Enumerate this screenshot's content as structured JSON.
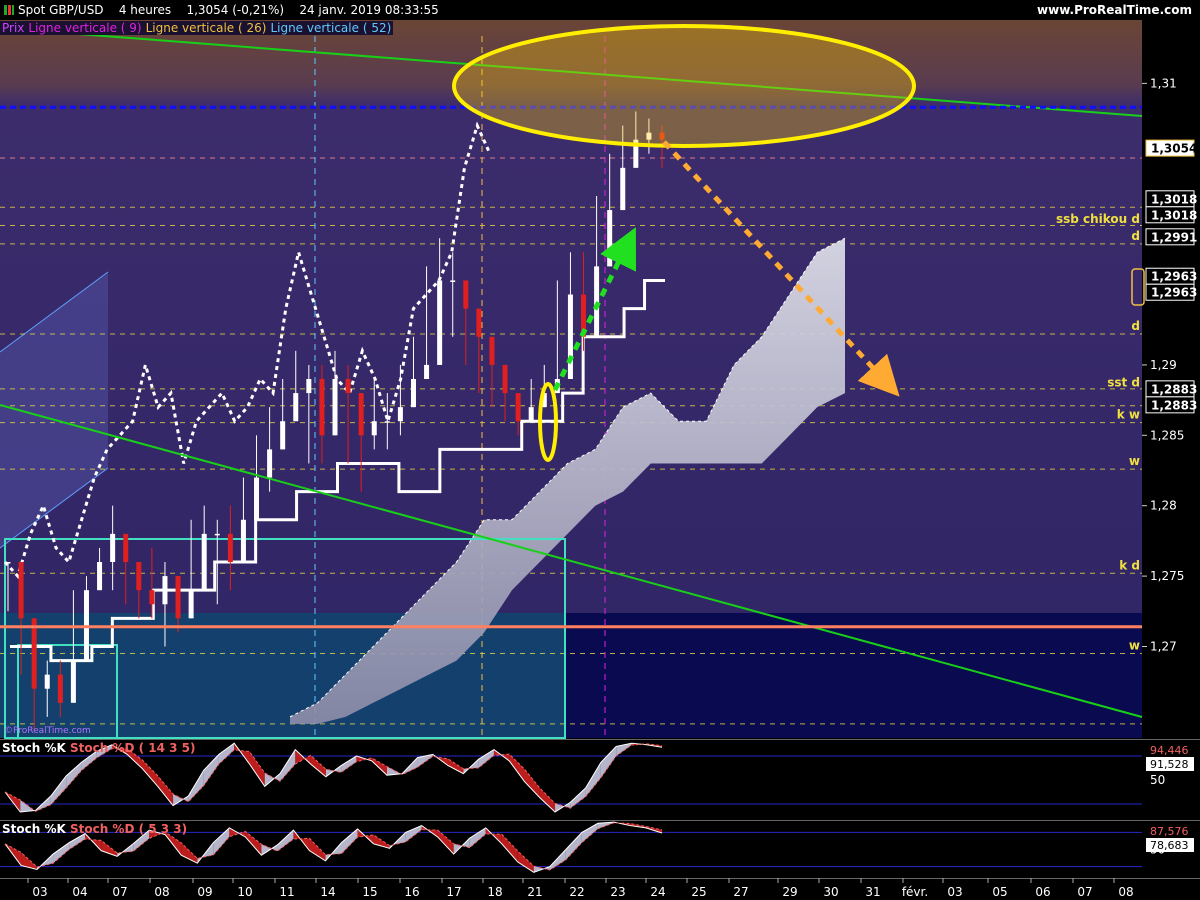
{
  "header": {
    "instrument": "Spot GBP/USD",
    "timeframe": "4 heures",
    "last": "1,3054 (-0,21%)",
    "datetime": "24 janv. 2019 08:33:55",
    "brand": "www.ProRealTime.com"
  },
  "legend": [
    {
      "text": "Prix",
      "color": "#cc44ff"
    },
    {
      "text": "Ligne verticale ( 9)",
      "color": "#e020e0"
    },
    {
      "text": "Ligne verticale ( 26)",
      "color": "#f0c040"
    },
    {
      "text": "Ligne verticale ( 52)",
      "color": "#60c8ff"
    }
  ],
  "watermark": "©ProRealTime.com",
  "colors": {
    "background_top": "#6b4535",
    "background": "#3a2a6a",
    "background_bottom": "#0a0a50",
    "ichimoku_cloud": "#c8c8d8",
    "trend_line": "#18d018",
    "resistance_dotted": "#1010ff",
    "support_horizontal": "#ff8060",
    "arrow_projection": "#ffaa33",
    "arrow_breakout": "#20e020",
    "highlight_ellipse": "#ffee00",
    "price_up": "#ffffff",
    "price_down": "#e02020",
    "box": "#40e0c0"
  },
  "chart_data": [
    {
      "type": "line",
      "title": "",
      "description_series": "Spot GBP/USD 4h with Ichimoku (Kijun, Chikou, Kumo), trend lines",
      "ylim": [
        1.2635,
        1.3145
      ],
      "x_ticks": [
        "03",
        "04",
        "07",
        "08",
        "09",
        "10",
        "11",
        "14",
        "15",
        "16",
        "17",
        "18",
        "21",
        "22",
        "23",
        "24",
        "25",
        "27",
        "29",
        "30",
        "31",
        "févr.",
        "03",
        "05",
        "06",
        "07",
        "08"
      ],
      "y_ticks": [
        {
          "value": 1.31,
          "label": "1,31"
        },
        {
          "value": 1.29,
          "label": "1,29"
        },
        {
          "value": 1.285,
          "label": "1,285"
        },
        {
          "value": 1.28,
          "label": "1,28"
        },
        {
          "value": 1.275,
          "label": "1,275"
        },
        {
          "value": 1.27,
          "label": "1,27"
        }
      ],
      "price_tags": [
        {
          "value": 1.3054,
          "label": "1,3054",
          "highlight": true
        },
        {
          "value": 1.3018,
          "label": "1,3018"
        },
        {
          "value": 1.3018,
          "label": "1,3018"
        },
        {
          "value": 1.2991,
          "label": "1,2991"
        },
        {
          "value": 1.2963,
          "label": "1,2963"
        },
        {
          "value": 1.2963,
          "label": "1,2963"
        },
        {
          "value": 1.2883,
          "label": "1,2883"
        },
        {
          "value": 1.2883,
          "label": "1,2883"
        }
      ],
      "level_labels": [
        {
          "value": 1.2998,
          "label": "ssb chikou d"
        },
        {
          "value": 1.2986,
          "label": "d"
        },
        {
          "value": 1.2922,
          "label": "d"
        },
        {
          "value": 1.2882,
          "label": "sst d"
        },
        {
          "value": 1.2859,
          "label": "k w"
        },
        {
          "value": 1.2826,
          "label": "w"
        },
        {
          "value": 1.2752,
          "label": "k d"
        },
        {
          "value": 1.2695,
          "label": "w"
        }
      ],
      "dashed_levels": [
        1.3047,
        1.3012,
        1.2999,
        1.2986,
        1.2922,
        1.2883,
        1.2871,
        1.2859,
        1.2826,
        1.2752,
        1.2695,
        1.2645
      ],
      "resistance_level": 1.3083,
      "support_level": 1.2714,
      "vertical_lines": [
        {
          "name": "Ligne verticale ( 52)",
          "date": "14",
          "color": "#60c8ff"
        },
        {
          "name": "Ligne verticale ( 26)",
          "date": "18",
          "color": "#f0c040"
        },
        {
          "name": "Ligne verticale ( 9)",
          "date": "23",
          "color": "#e020e0"
        }
      ],
      "candles": [
        [
          1.276,
          1.2755,
          1.2725
        ],
        [
          1.272,
          1.271,
          1.268
        ],
        [
          1.267,
          1.27,
          1.264
        ],
        [
          1.268,
          1.269,
          1.265
        ],
        [
          1.266,
          1.269,
          1.265
        ],
        [
          1.269,
          1.274,
          1.268
        ],
        [
          1.274,
          1.275,
          1.272
        ],
        [
          1.276,
          1.277,
          1.274
        ],
        [
          1.278,
          1.28,
          1.274
        ],
        [
          1.276,
          1.277,
          1.273
        ],
        [
          1.274,
          1.276,
          1.272
        ],
        [
          1.273,
          1.277,
          1.272
        ],
        [
          1.275,
          1.276,
          1.27
        ],
        [
          1.272,
          1.275,
          1.271
        ],
        [
          1.274,
          1.279,
          1.273
        ],
        [
          1.278,
          1.28,
          1.276
        ],
        [
          1.278,
          1.279,
          1.273
        ],
        [
          1.276,
          1.28,
          1.274
        ],
        [
          1.279,
          1.282,
          1.278
        ],
        [
          1.282,
          1.285,
          1.28
        ],
        [
          1.284,
          1.287,
          1.281
        ],
        [
          1.286,
          1.289,
          1.284
        ],
        [
          1.288,
          1.291,
          1.286
        ],
        [
          1.289,
          1.29,
          1.283
        ],
        [
          1.285,
          1.29,
          1.283
        ],
        [
          1.289,
          1.291,
          1.286
        ],
        [
          1.288,
          1.29,
          1.283
        ],
        [
          1.285,
          1.288,
          1.281
        ],
        [
          1.286,
          1.289,
          1.284
        ],
        [
          1.286,
          1.288,
          1.284
        ],
        [
          1.287,
          1.29,
          1.285
        ],
        [
          1.289,
          1.292,
          1.287
        ],
        [
          1.29,
          1.297,
          1.289
        ],
        [
          1.296,
          1.299,
          1.292
        ],
        [
          1.296,
          1.298,
          1.292
        ],
        [
          1.294,
          1.296,
          1.29
        ],
        [
          1.292,
          1.294,
          1.288
        ],
        [
          1.29,
          1.292,
          1.287
        ],
        [
          1.288,
          1.289,
          1.286
        ],
        [
          1.286,
          1.288,
          1.285
        ],
        [
          1.287,
          1.289,
          1.286
        ],
        [
          1.288,
          1.29,
          1.287
        ],
        [
          1.289,
          1.296,
          1.288
        ],
        [
          1.295,
          1.298,
          1.291
        ],
        [
          1.292,
          1.298,
          1.291
        ],
        [
          1.297,
          1.302,
          1.296
        ],
        [
          1.301,
          1.305,
          1.3
        ],
        [
          1.304,
          1.307,
          1.303
        ],
        [
          1.306,
          1.308,
          1.304
        ],
        [
          1.3065,
          1.3075,
          1.305
        ],
        [
          1.306,
          1.307,
          1.304
        ]
      ],
      "series": [
        {
          "name": "Chikou",
          "style": "dotted",
          "values": [
            1.276,
            1.275,
            1.278,
            1.28,
            1.277,
            1.276,
            1.279,
            1.282,
            1.284,
            1.285,
            1.286,
            1.29,
            1.287,
            1.288,
            1.283,
            1.286,
            1.287,
            1.288,
            1.286,
            1.287,
            1.289,
            1.288,
            1.294,
            1.298,
            1.295,
            1.292,
            1.289,
            1.288,
            1.291,
            1.289,
            1.286,
            1.289,
            1.294,
            1.295,
            1.296,
            1.298,
            1.304,
            1.307,
            1.305
          ]
        },
        {
          "name": "Kijun",
          "style": "solid",
          "values": [
            1.27,
            1.27,
            1.269,
            1.269,
            1.27,
            1.272,
            1.272,
            1.274,
            1.274,
            1.274,
            1.276,
            1.276,
            1.279,
            1.279,
            1.281,
            1.281,
            1.283,
            1.283,
            1.283,
            1.281,
            1.281,
            1.284,
            1.284,
            1.284,
            1.284,
            1.286,
            1.286,
            1.288,
            1.292,
            1.292,
            1.294,
            1.296,
            1.296
          ]
        },
        {
          "name": "Kumo",
          "style": "area",
          "values": [
            1.265,
            1.266,
            1.268,
            1.27,
            1.272,
            1.274,
            1.276,
            1.279,
            1.279,
            1.281,
            1.283,
            1.284,
            1.287,
            1.288,
            1.286,
            1.286,
            1.29,
            1.292,
            1.295,
            1.298,
            1.299
          ]
        }
      ]
    },
    {
      "type": "area",
      "title": "Stoch %K Stoch %D ( 14 3 5)",
      "labels": {
        "k": "Stoch %K",
        "d": "Stoch %D ( 14 3 5)"
      },
      "ticks": [
        {
          "value": 50,
          "label": "50"
        }
      ],
      "tags": [
        {
          "value": 94.446,
          "label": "94,446"
        },
        {
          "value": 91.528,
          "label": "91,528"
        }
      ],
      "ylim": [
        0,
        100
      ],
      "values": [
        35,
        10,
        12,
        30,
        55,
        72,
        86,
        94,
        82,
        64,
        42,
        18,
        30,
        62,
        82,
        96,
        70,
        42,
        58,
        88,
        70,
        54,
        68,
        80,
        74,
        56,
        58,
        78,
        82,
        68,
        58,
        76,
        88,
        74,
        48,
        28,
        10,
        22,
        40,
        72,
        92,
        96,
        94,
        91
      ]
    },
    {
      "type": "line",
      "title": "Stoch %K Stoch %D ( 5 3 3)",
      "labels": {
        "k": "Stoch %K",
        "d": "Stoch %D ( 5 3 3)"
      },
      "ticks": [
        {
          "value": 50,
          "label": "50"
        }
      ],
      "tags": [
        {
          "value": 87.576,
          "label": "87,576"
        },
        {
          "value": 78.683,
          "label": "78,683"
        }
      ],
      "ylim": [
        0,
        100
      ],
      "values": [
        60,
        22,
        15,
        42,
        62,
        78,
        48,
        38,
        60,
        84,
        76,
        40,
        26,
        62,
        88,
        72,
        40,
        58,
        84,
        48,
        30,
        62,
        86,
        60,
        52,
        80,
        92,
        72,
        42,
        70,
        88,
        60,
        28,
        10,
        20,
        50,
        80,
        96,
        98,
        92,
        88,
        79
      ]
    }
  ]
}
